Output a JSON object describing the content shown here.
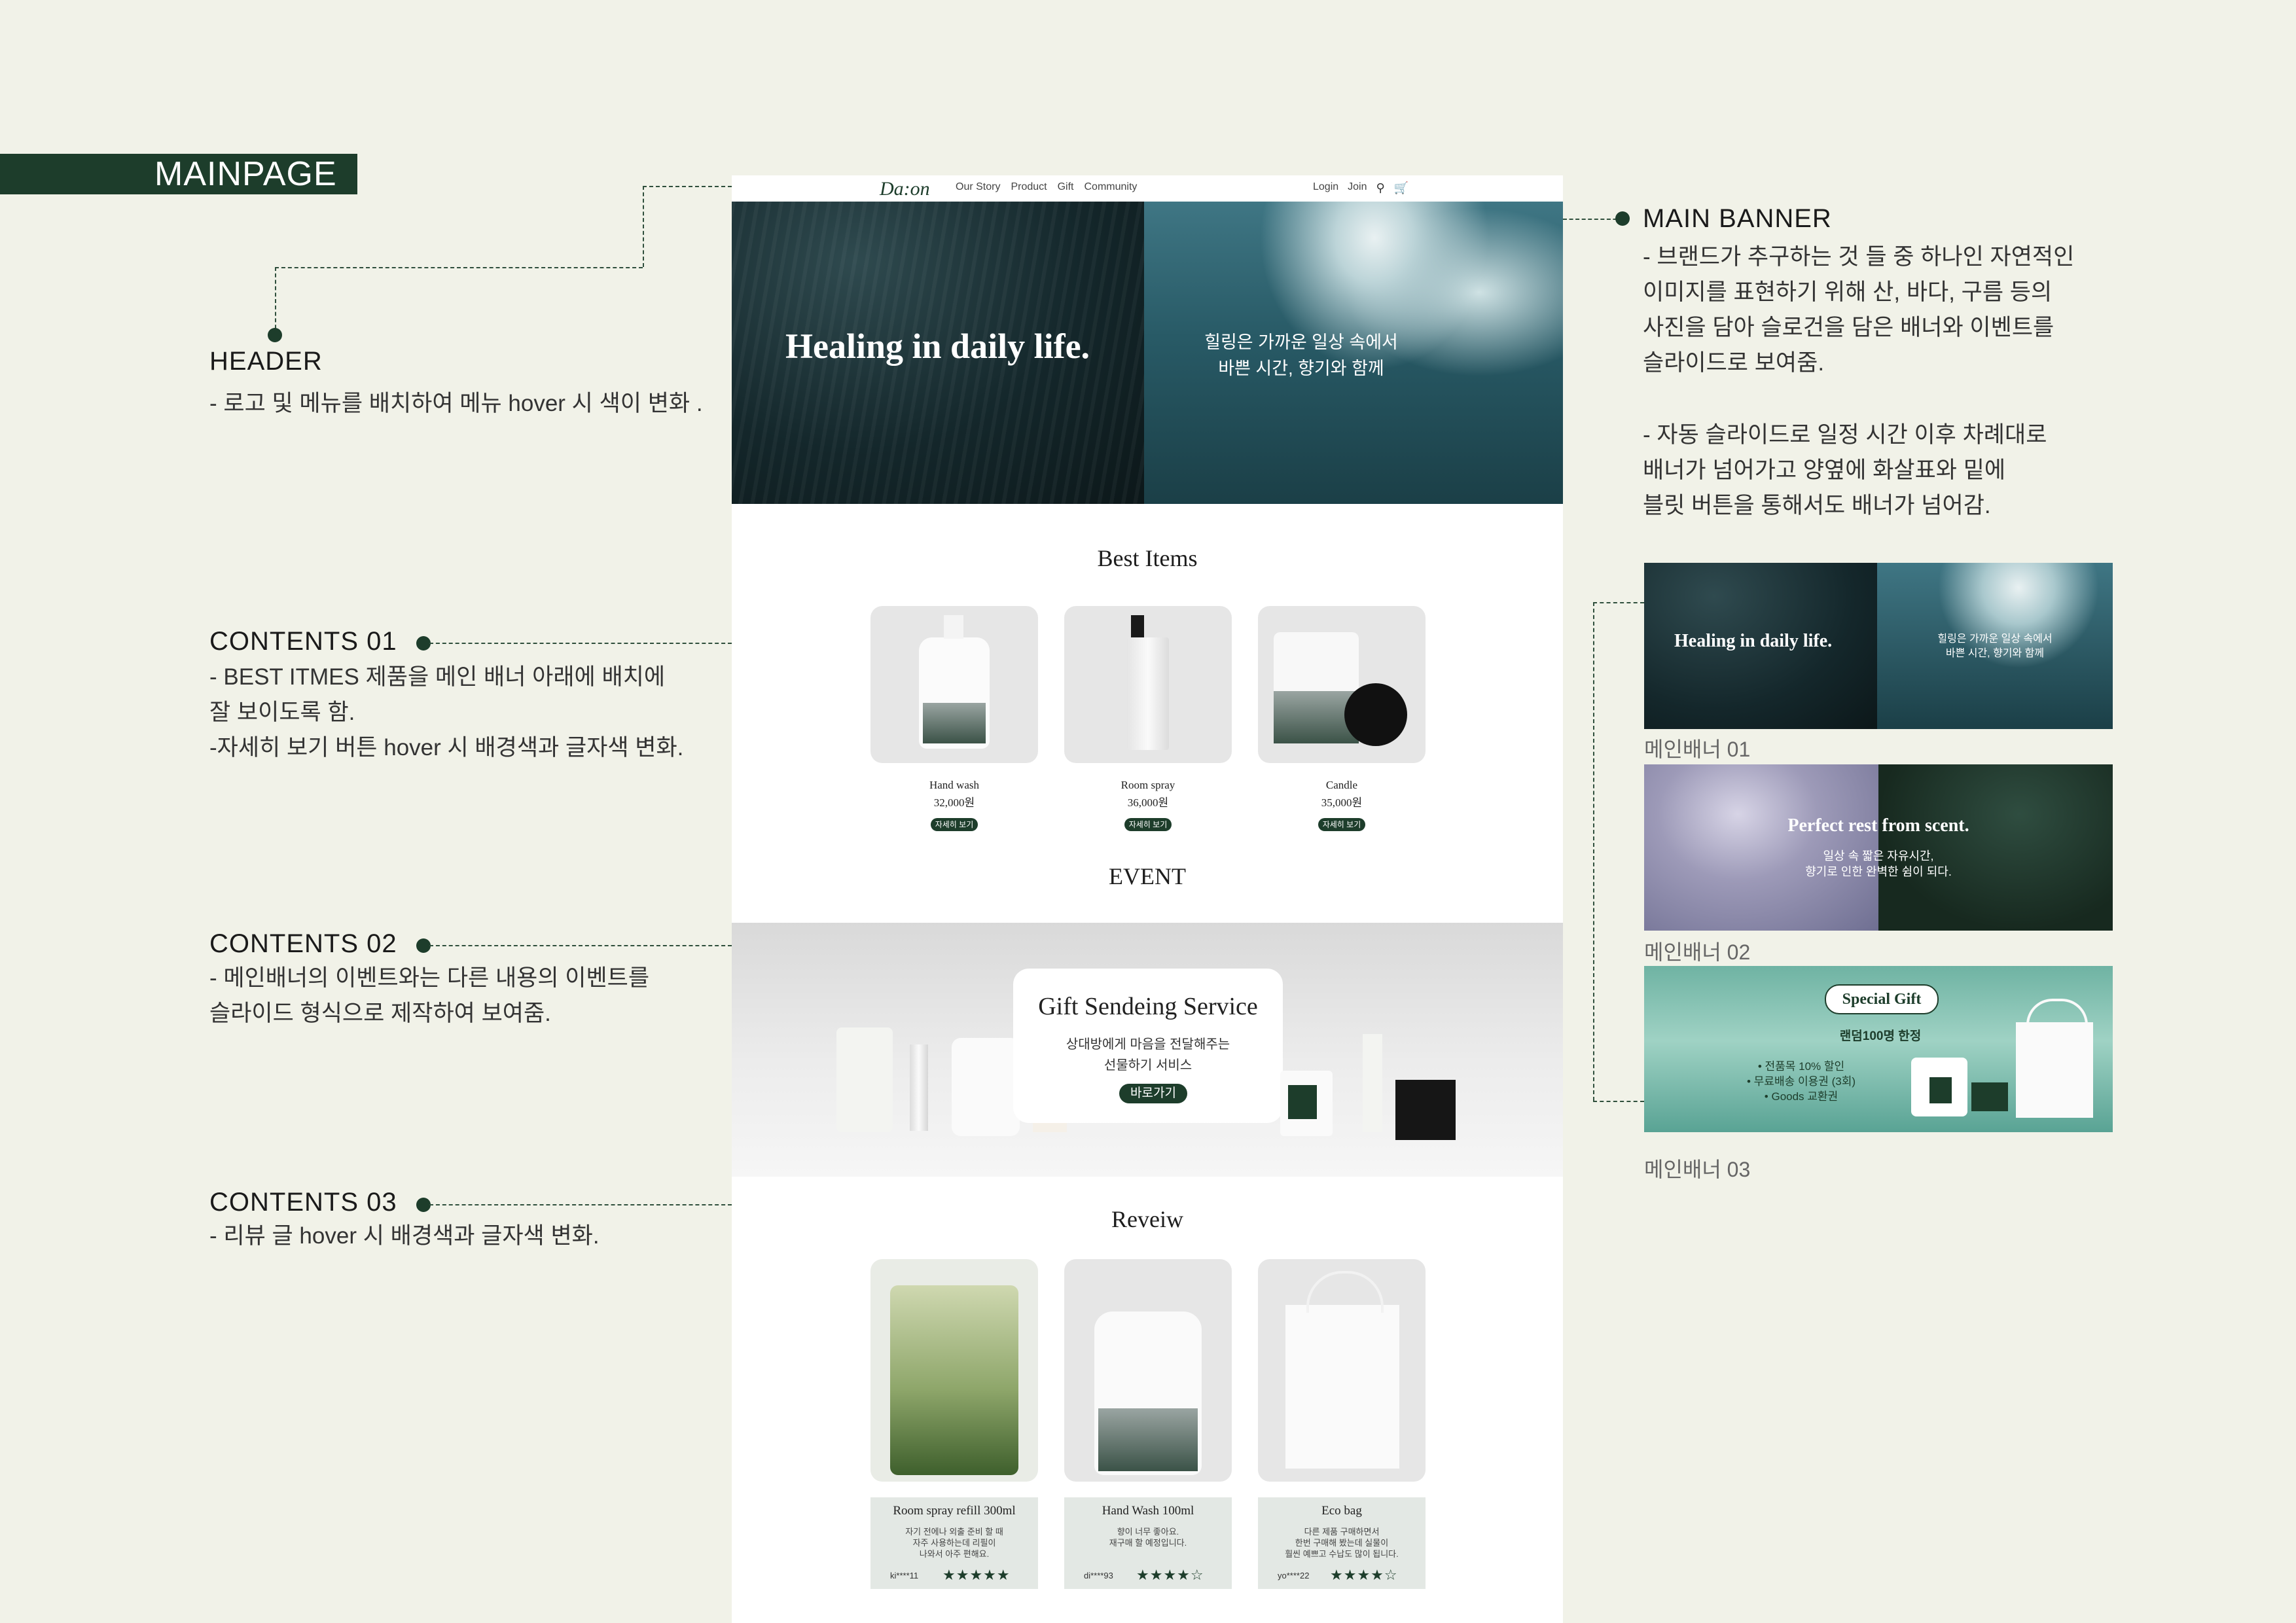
{
  "annotations": {
    "mainpage_label": "MAINPAGE",
    "header": {
      "title": "HEADER",
      "text": "- 로고 및 메뉴를 배치하여 메뉴 hover 시 색이  변화 ."
    },
    "contents01": {
      "title": "CONTENTS 01",
      "text": "- BEST ITMES 제품을 메인 배너 아래에 배치에\n잘 보이도록 함.\n-자세히 보기 버튼 hover 시 배경색과 글자색 변화."
    },
    "contents02": {
      "title": "CONTENTS 02",
      "text": "- 메인배너의 이벤트와는 다른 내용의 이벤트를\n 슬라이드 형식으로 제작하여 보여줌."
    },
    "contents03": {
      "title": "CONTENTS 03",
      "text": "- 리뷰 글 hover 시 배경색과 글자색 변화."
    },
    "main_banner": {
      "title": "MAIN BANNER",
      "text1": "- 브랜드가 추구하는 것 들 중 하나인 자연적인\n이미지를 표현하기 위해 산, 바다, 구름 등의\n사진을 담아 슬로건을 담은 배너와 이벤트를\n슬라이드로 보여줌.",
      "text2": "- 자동 슬라이드로 일정 시간 이후 차례대로\n배너가 넘어가고 양옆에 화살표와 밑에\n블릿 버튼을 통해서도 배너가 넘어감."
    }
  },
  "site": {
    "logo": "Da:on",
    "nav": [
      "Our Story",
      "Product",
      "Gift",
      "Community"
    ],
    "nav_right": [
      "Login",
      "Join"
    ],
    "banner": {
      "title": "Healing in daily life.",
      "subtitle": "힐링은 가까운 일상 속에서\n바쁜 시간, 향기와 함께"
    },
    "best_items": {
      "title": "Best Items",
      "products": [
        {
          "name": "Hand wash",
          "price": "32,000원",
          "button": "자세히 보기"
        },
        {
          "name": "Room spray",
          "price": "36,000원",
          "button": "자세히 보기"
        },
        {
          "name": "Candle",
          "price": "35,000원",
          "button": "자세히 보기"
        }
      ]
    },
    "event": {
      "title": "EVENT",
      "card_title": "Gift Sendeing Service",
      "card_text": "상대방에게 마음을 전달해주는\n선물하기 서비스",
      "button": "바로가기"
    },
    "review": {
      "title": "Reveiw",
      "items": [
        {
          "title": "Room spray refill 300ml",
          "text": "자기 전에나 외출 준비 할 때\n자주 사용하는데 리필이\n나와서 아주 편해요.",
          "user": "ki****11",
          "stars": "★★★★★"
        },
        {
          "title": "Hand Wash 100ml",
          "text": "향이 너무 좋아요.\n재구매 할 예정입니다.",
          "user": "di****93",
          "stars": "★★★★☆"
        },
        {
          "title": "Eco bag",
          "text": "다른 제품 구매하면서\n한번 구매해 봤는데 실물이\n훨씬 예쁘고 수납도 많이 됩니다.",
          "user": "yo****22",
          "stars": "★★★★☆"
        }
      ]
    }
  },
  "thumbnails": [
    {
      "label": "메인배너 01",
      "title": "Healing in daily life.",
      "text": "힐링은 가까운 일상 속에서\n바쁜 시간, 향기와 함께"
    },
    {
      "label": "메인배너 02",
      "title": "Perfect rest from scent.",
      "text": "일상 속 짧은 자유시간,\n향기로 인한 완벽한 쉼이 되다."
    },
    {
      "label": "메인배너 03",
      "badge": "Special Gift",
      "title": "랜덤100명 한정",
      "list": [
        "• 전품목 10% 할인",
        "• 무료배송 이용권 (3회)",
        "• Goods 교환권"
      ]
    }
  ]
}
